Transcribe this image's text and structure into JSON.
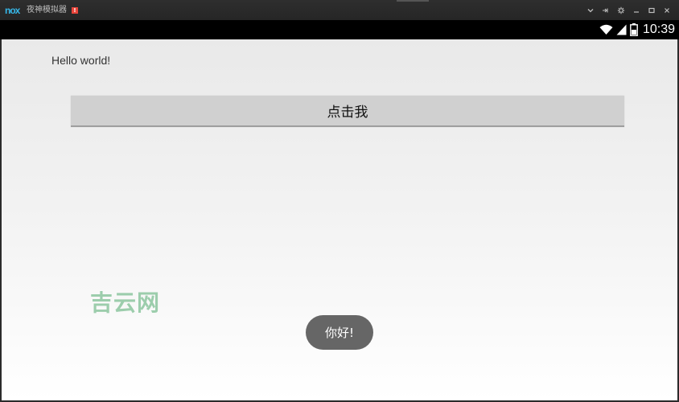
{
  "window": {
    "title": "夜神模拟器",
    "logo_text": "nox",
    "badge": "!",
    "controls": [
      "chevron-down-icon",
      "pin-icon",
      "gear-icon",
      "minimize-icon",
      "maximize-icon",
      "close-icon"
    ]
  },
  "statusbar": {
    "time": "10:39",
    "icons": [
      "wifi-icon",
      "signal-icon",
      "battery-icon"
    ]
  },
  "app": {
    "hello_text": "Hello world!",
    "button_label": "点击我",
    "toast_text": "你好!",
    "watermark": "吉云网"
  },
  "colors": {
    "nox_accent": "#36b7e8",
    "badge": "#e8443a",
    "toast_bg": "#666666",
    "watermark": "#50aa6e"
  }
}
